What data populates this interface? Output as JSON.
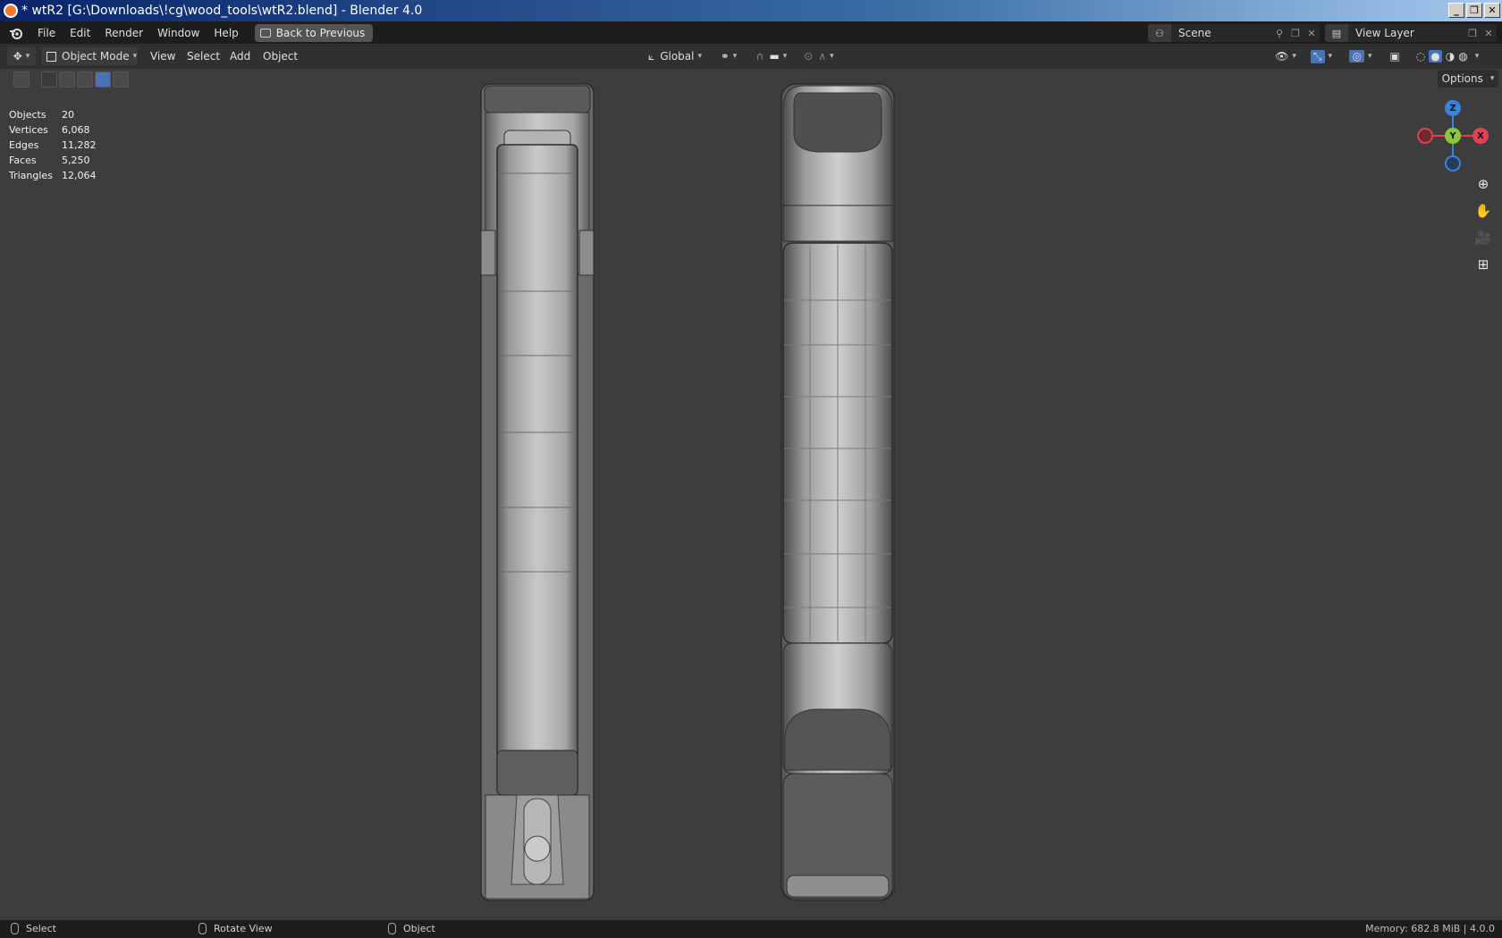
{
  "window": {
    "title": "* wtR2 [G:\\Downloads\\!cg\\wood_tools\\wtR2.blend] - Blender 4.0",
    "minimize": "_",
    "restore": "❐",
    "close": "✕"
  },
  "menubar": {
    "items": [
      "File",
      "Edit",
      "Render",
      "Window",
      "Help"
    ],
    "back_button": "Back to Previous",
    "scene_label": "Scene",
    "view_layer_label": "View Layer"
  },
  "viewport_header": {
    "mode": "Object Mode",
    "menus": [
      "View",
      "Select",
      "Add",
      "Object"
    ],
    "transform_orientation": "Global",
    "options_label": "Options"
  },
  "stats": [
    {
      "label": "Objects",
      "value": "20"
    },
    {
      "label": "Vertices",
      "value": "6,068"
    },
    {
      "label": "Edges",
      "value": "11,282"
    },
    {
      "label": "Faces",
      "value": "5,250"
    },
    {
      "label": "Triangles",
      "value": "12,064"
    }
  ],
  "gizmo": {
    "z": "Z",
    "y": "Y",
    "x": "X"
  },
  "statusbar": {
    "select": "Select",
    "rotate": "Rotate View",
    "object": "Object",
    "memory": "Memory: 682.8 MiB | 4.0.0"
  },
  "colors": {
    "viewport_bg": "#3d3d3d",
    "header_bg": "#303030",
    "topbar_bg": "#1d1d1d",
    "axis_x": "#e0434f",
    "axis_y": "#8dc83a",
    "axis_z": "#3d82d6",
    "active_blue": "#4772b3"
  }
}
